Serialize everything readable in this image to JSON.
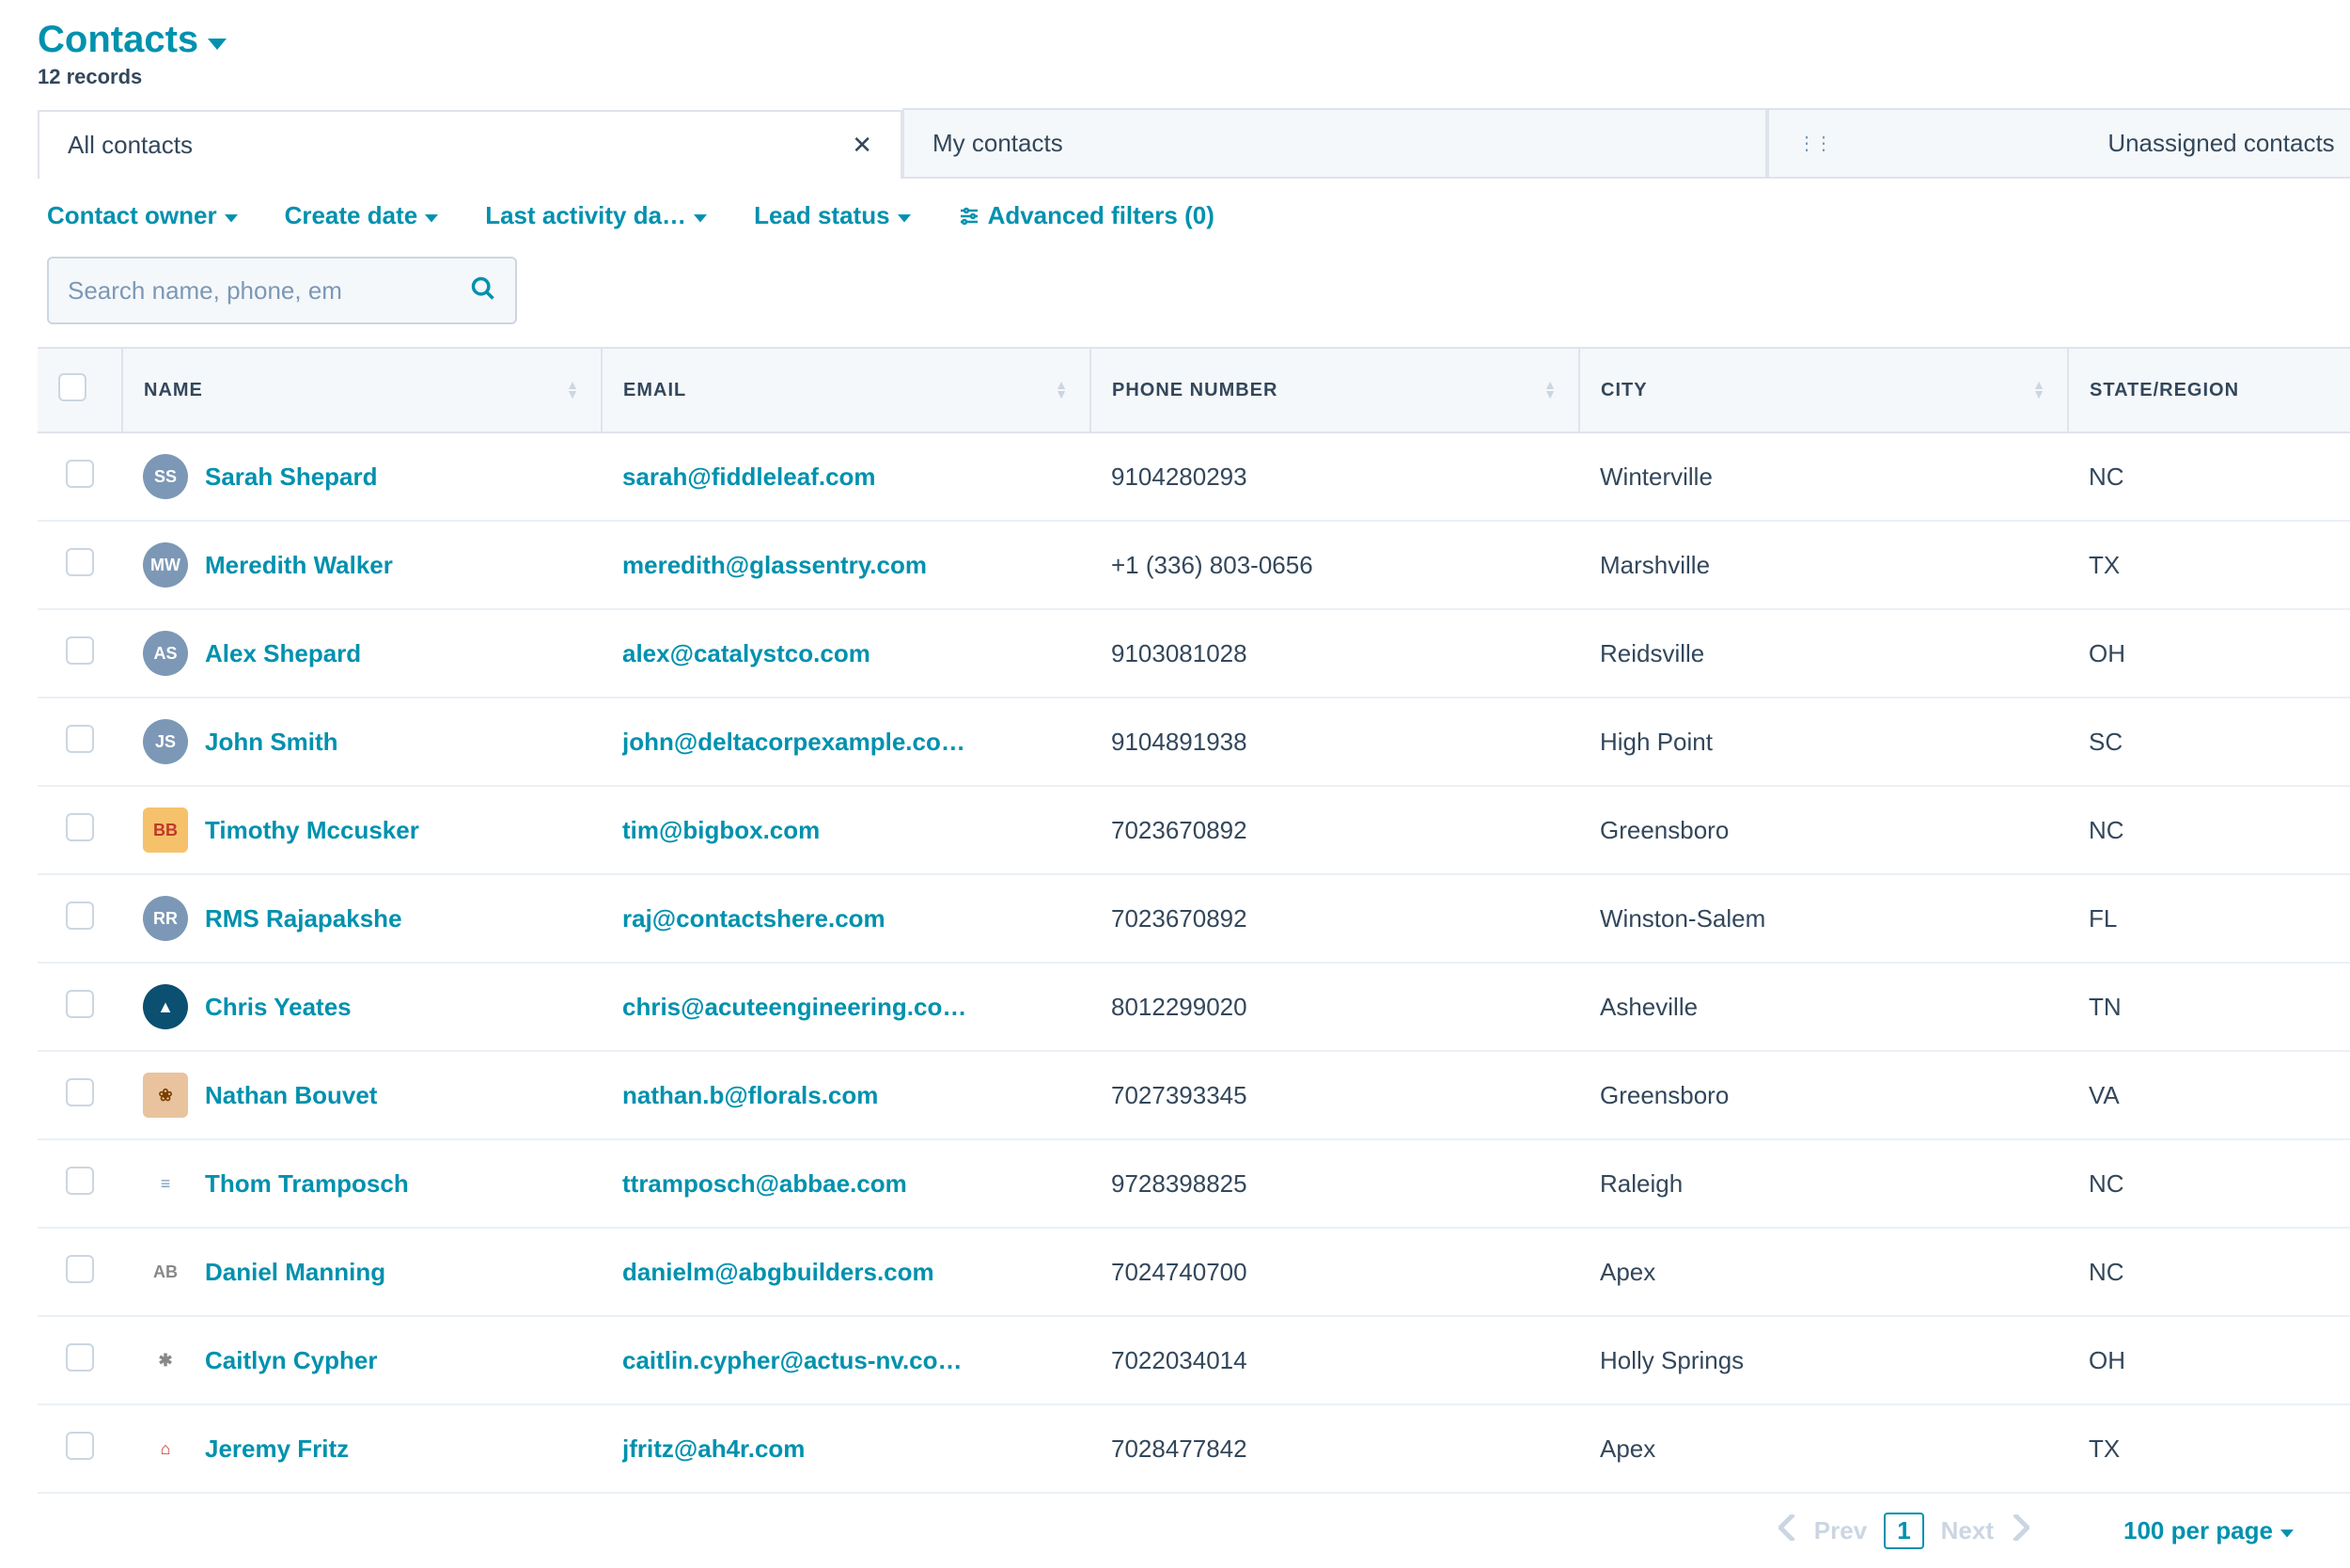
{
  "header": {
    "title": "Contacts",
    "record_count": "12 records"
  },
  "tabs": [
    {
      "label": "All contacts",
      "active": true,
      "closable": true
    },
    {
      "label": "My contacts",
      "active": false,
      "closable": false
    },
    {
      "label": "Unassigned contacts",
      "active": false,
      "closable": false,
      "draggable": true
    }
  ],
  "filters": {
    "contact_owner": "Contact owner",
    "create_date": "Create date",
    "last_activity": "Last activity da…",
    "lead_status": "Lead status",
    "advanced": "Advanced filters (0)"
  },
  "search": {
    "placeholder": "Search name, phone, em"
  },
  "columns": {
    "name": "NAME",
    "email": "EMAIL",
    "phone": "PHONE NUMBER",
    "city": "CITY",
    "state": "STATE/REGION"
  },
  "rows": [
    {
      "initials": "SS",
      "avatar_bg": "#7c98b6",
      "avatar_fg": "#fff",
      "shape": "circle",
      "name": "Sarah Shepard",
      "email": "sarah@fiddleleaf.com",
      "phone": "9104280293",
      "city": "Winterville",
      "state": "NC"
    },
    {
      "initials": "MW",
      "avatar_bg": "#7c98b6",
      "avatar_fg": "#fff",
      "shape": "circle",
      "name": "Meredith Walker",
      "email": "meredith@glassentry.com",
      "phone": "+1 (336) 803-0656",
      "city": "Marshville",
      "state": "TX"
    },
    {
      "initials": "AS",
      "avatar_bg": "#7c98b6",
      "avatar_fg": "#fff",
      "shape": "circle",
      "name": "Alex Shepard",
      "email": "alex@catalystco.com",
      "phone": "9103081028",
      "city": "Reidsville",
      "state": "OH"
    },
    {
      "initials": "JS",
      "avatar_bg": "#7c98b6",
      "avatar_fg": "#fff",
      "shape": "circle",
      "name": "John Smith",
      "email": "john@deltacorpexample.co…",
      "phone": "9104891938",
      "city": "High Point",
      "state": "SC"
    },
    {
      "initials": "BB",
      "avatar_bg": "#f5c26b",
      "avatar_fg": "#c0392b",
      "shape": "square",
      "name": "Timothy Mccusker",
      "email": "tim@bigbox.com",
      "phone": "7023670892",
      "city": "Greensboro",
      "state": "NC"
    },
    {
      "initials": "RR",
      "avatar_bg": "#7c98b6",
      "avatar_fg": "#fff",
      "shape": "circle",
      "name": "RMS Rajapakshe",
      "email": "raj@contactshere.com",
      "phone": "7023670892",
      "city": "Winston-Salem",
      "state": "FL"
    },
    {
      "initials": "▲",
      "avatar_bg": "#0b4f71",
      "avatar_fg": "#fff",
      "shape": "circle",
      "name": "Chris Yeates",
      "email": "chris@acuteengineering.co…",
      "phone": "8012299020",
      "city": "Asheville",
      "state": "TN"
    },
    {
      "initials": "❀",
      "avatar_bg": "#e8c39e",
      "avatar_fg": "#7b3f00",
      "shape": "square",
      "name": "Nathan Bouvet",
      "email": "nathan.b@florals.com",
      "phone": "7027393345",
      "city": "Greensboro",
      "state": "VA"
    },
    {
      "initials": "≡",
      "avatar_bg": "#ffffff",
      "avatar_fg": "#7c98b6",
      "shape": "square",
      "name": "Thom Tramposch",
      "email": "ttramposch@abbae.com",
      "phone": "9728398825",
      "city": "Raleigh",
      "state": "NC"
    },
    {
      "initials": "AB",
      "avatar_bg": "#ffffff",
      "avatar_fg": "#888",
      "shape": "square",
      "name": "Daniel Manning",
      "email": "danielm@abgbuilders.com",
      "phone": "7024740700",
      "city": "Apex",
      "state": "NC"
    },
    {
      "initials": "✱",
      "avatar_bg": "#ffffff",
      "avatar_fg": "#888",
      "shape": "square",
      "name": "Caitlyn Cypher",
      "email": "caitlin.cypher@actus-nv.co…",
      "phone": "7022034014",
      "city": "Holly Springs",
      "state": "OH"
    },
    {
      "initials": "⌂",
      "avatar_bg": "#ffffff",
      "avatar_fg": "#c0392b",
      "shape": "square",
      "name": "Jeremy Fritz",
      "email": "jfritz@ah4r.com",
      "phone": "7028477842",
      "city": "Apex",
      "state": "TX"
    }
  ],
  "pager": {
    "prev": "Prev",
    "page": "1",
    "next": "Next",
    "per_page": "100 per page"
  }
}
